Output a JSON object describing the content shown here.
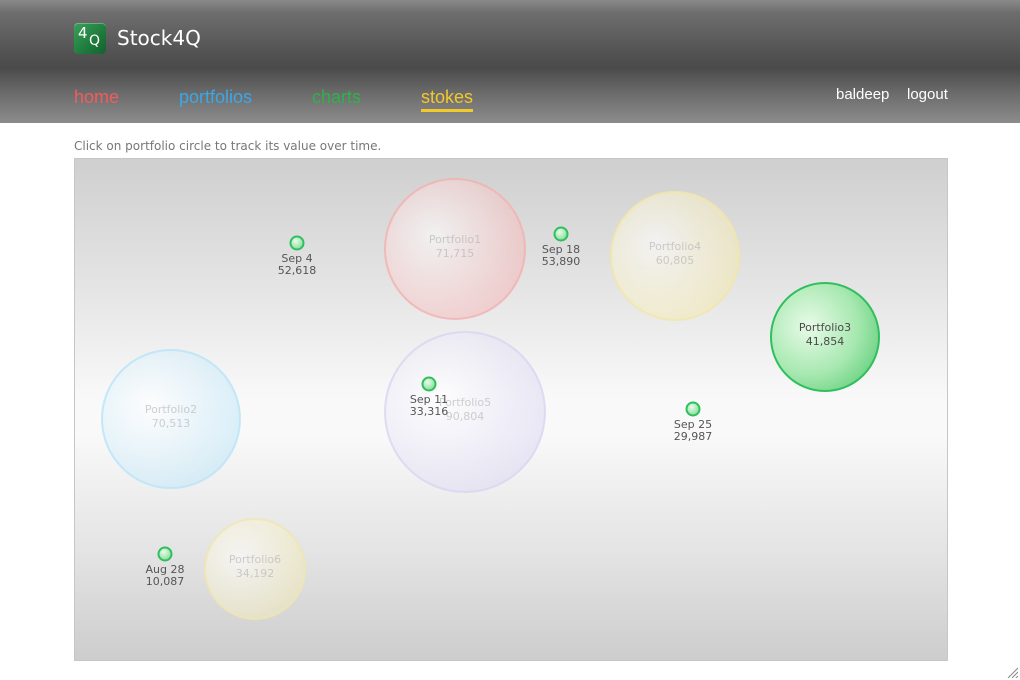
{
  "app": {
    "logo_text_main": "4",
    "logo_text_sub": "Q",
    "title": "Stock4Q"
  },
  "nav": {
    "home": "home",
    "portfolios": "portfolios",
    "charts": "charts",
    "stokes": "stokes"
  },
  "user": {
    "name": "baldeep",
    "logout": "logout"
  },
  "hint": "Click on portfolio circle to track its value over time.",
  "portfolios": [
    {
      "name": "Portfolio1",
      "value": "71,715",
      "color": "#f3b0b0",
      "active": false
    },
    {
      "name": "Portfolio2",
      "value": "70,513",
      "color": "#b9e3f7",
      "active": false
    },
    {
      "name": "Portfolio3",
      "value": "41,854",
      "color": "#2fbf5e",
      "active": true
    },
    {
      "name": "Portfolio4",
      "value": "60,805",
      "color": "#f3e6a6",
      "active": false
    },
    {
      "name": "Portfolio5",
      "value": "90,804",
      "color": "#d8d4f0",
      "active": false
    },
    {
      "name": "Portfolio6",
      "value": "34,192",
      "color": "#efe6b0",
      "active": false
    }
  ],
  "chart_data": {
    "type": "scatter",
    "series": [
      {
        "name": "Portfolio3",
        "points": [
          {
            "date": "Aug 28",
            "value": "10,087"
          },
          {
            "date": "Sep 4",
            "value": "52,618"
          },
          {
            "date": "Sep 11",
            "value": "33,316"
          },
          {
            "date": "Sep 18",
            "value": "53,890"
          },
          {
            "date": "Sep 25",
            "value": "29,987"
          }
        ]
      }
    ]
  }
}
